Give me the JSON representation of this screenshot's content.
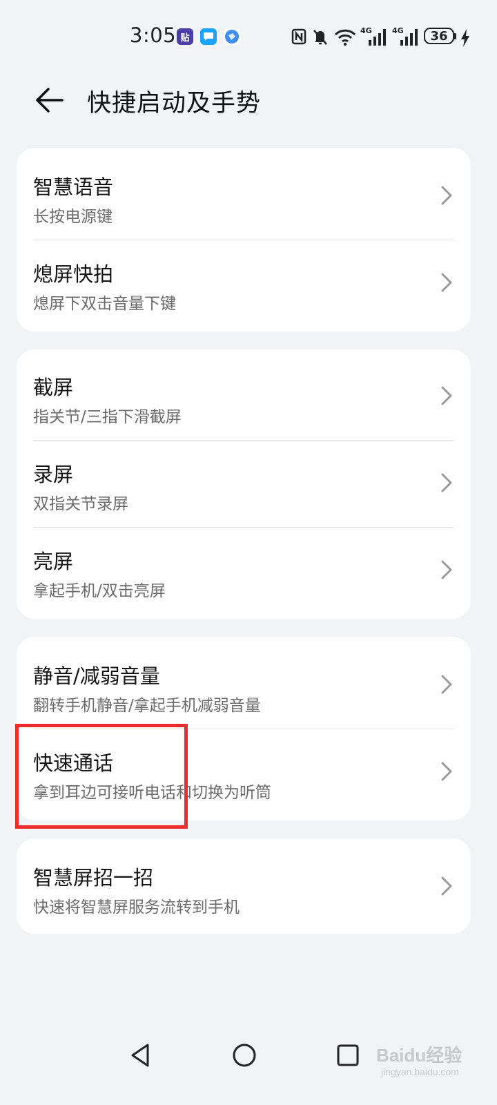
{
  "status_bar": {
    "time": "3:05",
    "notification_icons": [
      "tieba-icon",
      "message-icon",
      "browser-icon"
    ],
    "tieba_glyph": "贴",
    "network_1": "4G",
    "network_2": "4G",
    "battery_level": "36"
  },
  "header": {
    "back_icon": "arrow-left-icon",
    "title": "快捷启动及手势"
  },
  "groups": [
    {
      "items": [
        {
          "title": "智慧语音",
          "subtitle": "长按电源键"
        },
        {
          "title": "熄屏快拍",
          "subtitle": "熄屏下双击音量下键"
        }
      ]
    },
    {
      "items": [
        {
          "title": "截屏",
          "subtitle": "指关节/三指下滑截屏"
        },
        {
          "title": "录屏",
          "subtitle": "双指关节录屏"
        },
        {
          "title": "亮屏",
          "subtitle": "拿起手机/双击亮屏"
        }
      ]
    },
    {
      "items": [
        {
          "title": "静音/减弱音量",
          "subtitle": "翻转手机静音/拿起手机减弱音量"
        },
        {
          "title": "快速通话",
          "subtitle": "拿到耳边可接听电话和切换为听筒"
        }
      ]
    },
    {
      "items": [
        {
          "title": "智慧屏招一招",
          "subtitle": "快速将智慧屏服务流转到手机"
        }
      ]
    }
  ],
  "highlight_color": "#ef2c2c",
  "nav_bar": {
    "back": "triangle-back-icon",
    "home": "circle-home-icon",
    "recents": "square-recents-icon"
  },
  "watermark": {
    "text": "Baidu经验",
    "sub": "jingyan.baidu.com"
  }
}
